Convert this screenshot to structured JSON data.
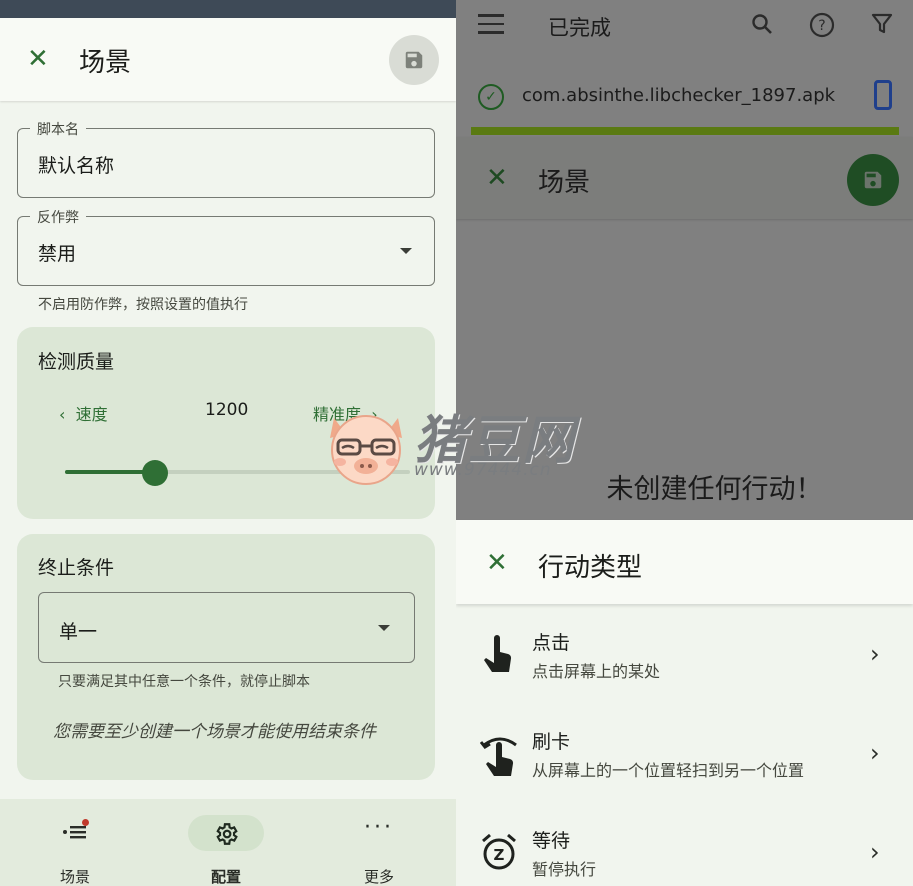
{
  "left": {
    "appbar": {
      "title": "场景"
    },
    "script_name": {
      "label": "脚本名",
      "value": "默认名称"
    },
    "anti_cheat": {
      "label": "反作弊",
      "value": "禁用",
      "help": "不启用防作弊，按照设置的值执行"
    },
    "quality": {
      "title": "检测质量",
      "speed_label": "速度",
      "precision_label": "精准度",
      "value": "1200",
      "slider_fraction": 0.26
    },
    "stop": {
      "title": "终止条件",
      "value": "单一",
      "help": "只要满足其中任意一个条件，就停止脚本",
      "note": "您需要至少创建一个场景才能使用结束条件"
    },
    "nav": [
      {
        "label": "场景",
        "icon": "list-icon"
      },
      {
        "label": "配置",
        "icon": "gear-icon"
      },
      {
        "label": "更多",
        "icon": "more-icon"
      }
    ]
  },
  "right": {
    "toolbar": {
      "title": "已完成"
    },
    "file_item": {
      "name": "com.absinthe.libchecker_1897.apk"
    },
    "scene_bar": {
      "title": "场景"
    },
    "empty_text": "未创建任何行动！",
    "sheet": {
      "title": "行动类型"
    },
    "actions": [
      {
        "title": "点击",
        "desc": "点击屏幕上的某处",
        "icon": "tap-icon"
      },
      {
        "title": "刷卡",
        "desc": "从屏幕上的一个位置轻扫到另一个位置",
        "icon": "swipe-icon"
      },
      {
        "title": "等待",
        "desc": "暂停执行",
        "icon": "alarm-icon"
      }
    ]
  },
  "watermark": {
    "title": "猪豆网",
    "url": "www.97444.cn"
  },
  "colors": {
    "accent": "#2f6f35",
    "card": "#dce7d6",
    "surface": "#f1f5ee",
    "scrim": "#808080"
  }
}
